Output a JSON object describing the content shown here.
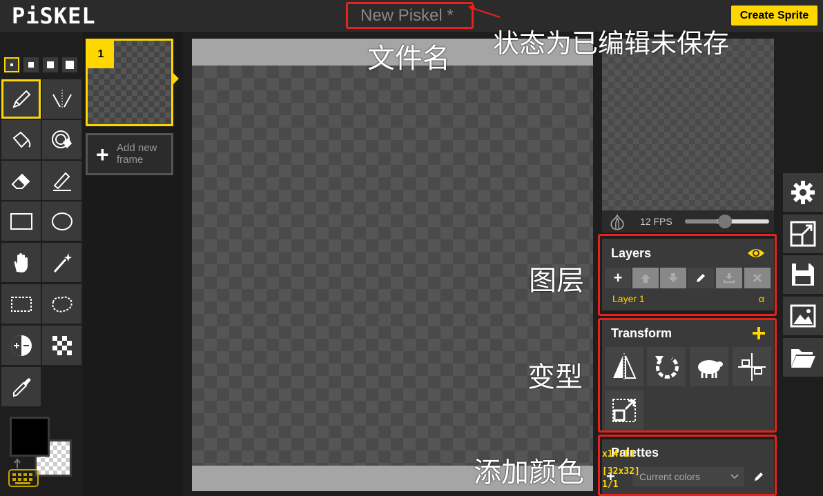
{
  "app": {
    "logo": "PiSKEL",
    "file_title": "New Piskel *",
    "create_sprite_label": "Create Sprite"
  },
  "annotations": {
    "status": "状态为已编辑未保存",
    "filename": "文件名",
    "layers": "图层",
    "transform": "变型",
    "add_color": "添加颜色"
  },
  "tools": {
    "pen_sizes": [
      1,
      2,
      3,
      4
    ],
    "selected_size": 1,
    "items": [
      {
        "name": "pen-tool",
        "icon": "pencil-icon",
        "selected": true
      },
      {
        "name": "vertical-mirror-pen-tool",
        "icon": "mirror-pen-icon"
      },
      {
        "name": "paint-bucket-tool",
        "icon": "bucket-icon"
      },
      {
        "name": "paint-same-color-tool",
        "icon": "target-bucket-icon"
      },
      {
        "name": "eraser-tool",
        "icon": "eraser-icon"
      },
      {
        "name": "stroke-tool",
        "icon": "stroke-icon"
      },
      {
        "name": "rectangle-tool",
        "icon": "rectangle-icon"
      },
      {
        "name": "circle-tool",
        "icon": "circle-icon"
      },
      {
        "name": "move-tool",
        "icon": "hand-icon"
      },
      {
        "name": "shape-selection-tool",
        "icon": "magic-wand-icon"
      },
      {
        "name": "rectangle-selection-tool",
        "icon": "rect-select-icon"
      },
      {
        "name": "lasso-selection-tool",
        "icon": "lasso-icon"
      },
      {
        "name": "lighten-tool",
        "icon": "lighten-icon"
      },
      {
        "name": "dithering-tool",
        "icon": "checker-icon"
      },
      {
        "name": "color-picker-tool",
        "icon": "eyedropper-icon"
      }
    ],
    "primary_color": "#000000",
    "secondary_color": "transparent"
  },
  "frames": {
    "items": [
      {
        "number": "1"
      }
    ],
    "add_label": "Add new frame"
  },
  "preview": {
    "fps_label": "12 FPS",
    "fps": 12
  },
  "layers": {
    "title": "Layers",
    "items": [
      {
        "name": "Layer 1",
        "alpha": "α"
      }
    ]
  },
  "transform": {
    "title": "Transform"
  },
  "palettes": {
    "title": "Palettes",
    "selected": "Current colors"
  },
  "status": {
    "cursor": "x14:13",
    "size": "[32x32]",
    "frame": "1/1"
  },
  "colors": {
    "accent": "#ffd700",
    "annotation_red": "#e8211c"
  }
}
